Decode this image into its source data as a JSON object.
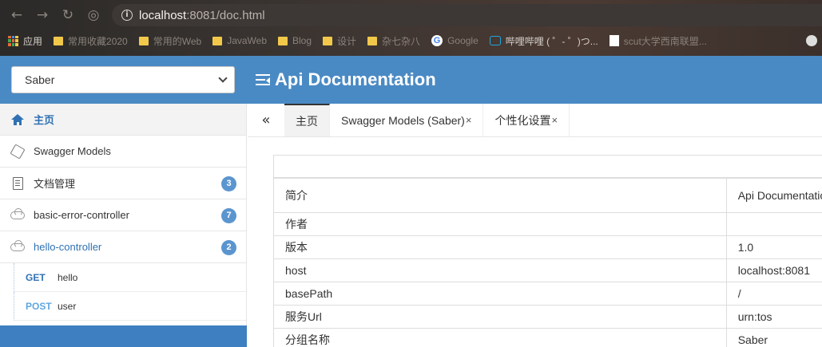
{
  "browser": {
    "url_host": "localhost",
    "url_port_path": ":8081/doc.html",
    "bookmarks": [
      {
        "label": "应用",
        "icon": "apps-grid-icon"
      },
      {
        "label": "常用收藏2020",
        "icon": "folder-icon"
      },
      {
        "label": "常用的Web",
        "icon": "folder-icon"
      },
      {
        "label": "JavaWeb",
        "icon": "folder-icon"
      },
      {
        "label": "Blog",
        "icon": "folder-icon"
      },
      {
        "label": "设计",
        "icon": "folder-icon"
      },
      {
        "label": "杂七杂八",
        "icon": "folder-icon"
      },
      {
        "label": "Google",
        "icon": "google-icon"
      },
      {
        "label": "哔哩哔哩 ( ゜- ゜)つ...",
        "icon": "bilibili-icon"
      },
      {
        "label": "scut大学西南联盟...",
        "icon": "page-icon"
      }
    ]
  },
  "header": {
    "group_selected": "Saber",
    "title": "Api Documentation"
  },
  "sidebar": {
    "items": [
      {
        "label": "主页",
        "icon": "home-icon"
      },
      {
        "label": "Swagger Models",
        "icon": "cube-icon"
      },
      {
        "label": "文档管理",
        "icon": "docs-icon",
        "badge": "3"
      },
      {
        "label": "basic-error-controller",
        "icon": "api-cloud-icon",
        "badge": "7"
      },
      {
        "label": "hello-controller",
        "icon": "api-cloud-icon",
        "badge": "2"
      }
    ],
    "endpoints": [
      {
        "method": "GET",
        "path": "hello"
      },
      {
        "method": "POST",
        "path": "user"
      }
    ]
  },
  "tabs": [
    {
      "label": "主页"
    },
    {
      "label": "Swagger Models (Saber)",
      "close": "×"
    },
    {
      "label": "个性化设置",
      "close": "×"
    }
  ],
  "collapse_icon": "«",
  "info_table": {
    "rows": [
      {
        "key": "简介",
        "value": "Api Documentation"
      },
      {
        "key": "作者",
        "value": ""
      },
      {
        "key": "版本",
        "value": "1.0"
      },
      {
        "key": "host",
        "value": "localhost:8081"
      },
      {
        "key": "basePath",
        "value": "/"
      },
      {
        "key": "服务Url",
        "value": "urn:tos"
      },
      {
        "key": "分组名称",
        "value": "Saber"
      }
    ]
  },
  "colors": {
    "header_blue": "#4a8ac4",
    "accent_blue": "#2f71b3",
    "badge_blue": "#5b95cf"
  }
}
